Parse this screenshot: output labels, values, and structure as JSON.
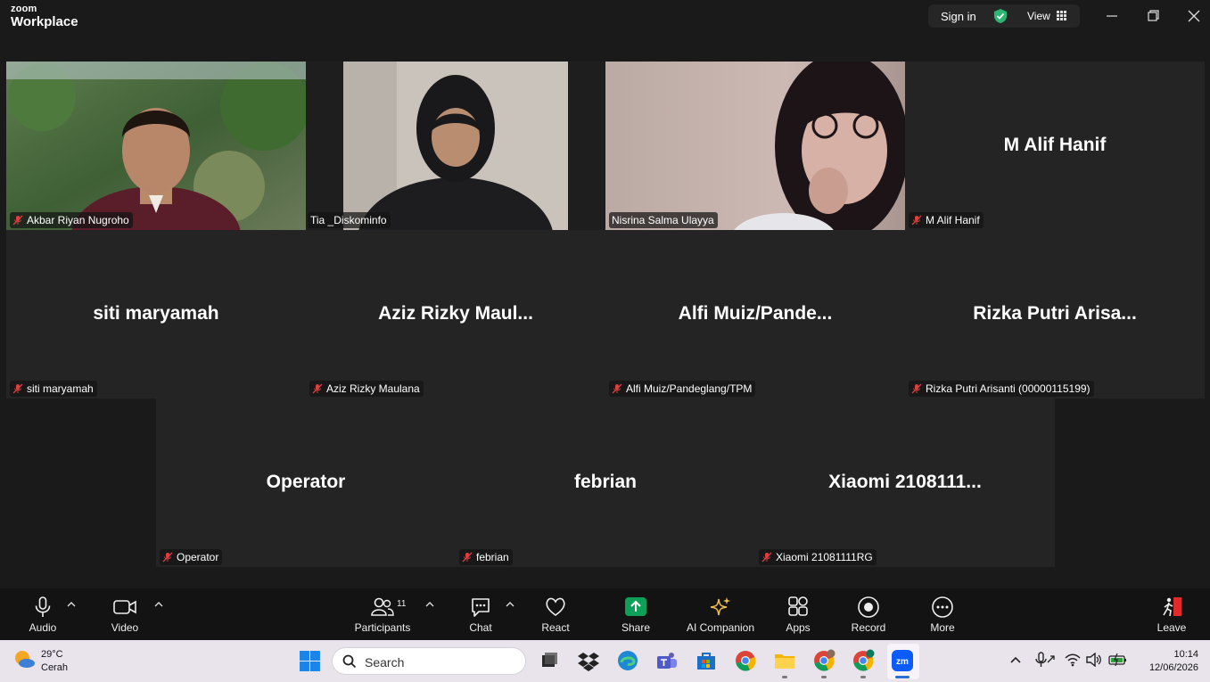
{
  "app": {
    "brand_small": "zoom",
    "brand_large": "Workplace"
  },
  "header": {
    "sign_in": "Sign in",
    "view": "View"
  },
  "participants": [
    {
      "name": "Akbar Riyan Nugroho",
      "display": "",
      "video": true,
      "muted": true
    },
    {
      "name": "Tia _Diskominfo",
      "display": "",
      "video": true,
      "muted": false
    },
    {
      "name": "Nisrina Salma Ulayya",
      "display": "",
      "video": true,
      "muted": false,
      "active": true
    },
    {
      "name": "M Alif Hanif",
      "display": "M Alif Hanif",
      "video": false,
      "muted": true
    },
    {
      "name": "siti maryamah",
      "display": "siti maryamah",
      "video": false,
      "muted": true
    },
    {
      "name": "Aziz Rizky Maulana",
      "display": "Aziz Rizky Maul...",
      "video": false,
      "muted": true
    },
    {
      "name": "Alfi Muiz/Pandeglang/TPM",
      "display": "Alfi Muiz/Pande...",
      "video": false,
      "muted": true
    },
    {
      "name": "Rizka Putri Arisanti (00000115199)",
      "display": "Rizka Putri Arisa...",
      "video": false,
      "muted": true
    },
    {
      "name": "Operator",
      "display": "Operator",
      "video": false,
      "muted": true
    },
    {
      "name": "febrian",
      "display": "febrian",
      "video": false,
      "muted": true
    },
    {
      "name": "Xiaomi 21081111RG",
      "display": "Xiaomi 2108111...",
      "video": false,
      "muted": true
    }
  ],
  "toolbar": {
    "audio": "Audio",
    "video": "Video",
    "participants": "Participants",
    "participants_count": "11",
    "chat": "Chat",
    "react": "React",
    "share": "Share",
    "ai_companion": "AI Companion",
    "apps": "Apps",
    "record": "Record",
    "more": "More",
    "leave": "Leave"
  },
  "taskbar": {
    "temperature": "29°C",
    "weather": "Cerah",
    "search_placeholder": "Search",
    "time": "10:14",
    "date": "12/06/2026"
  },
  "colors": {
    "accent_green": "#2bd48f",
    "share_green": "#0e9f58",
    "muted_red": "#e03e3e"
  }
}
